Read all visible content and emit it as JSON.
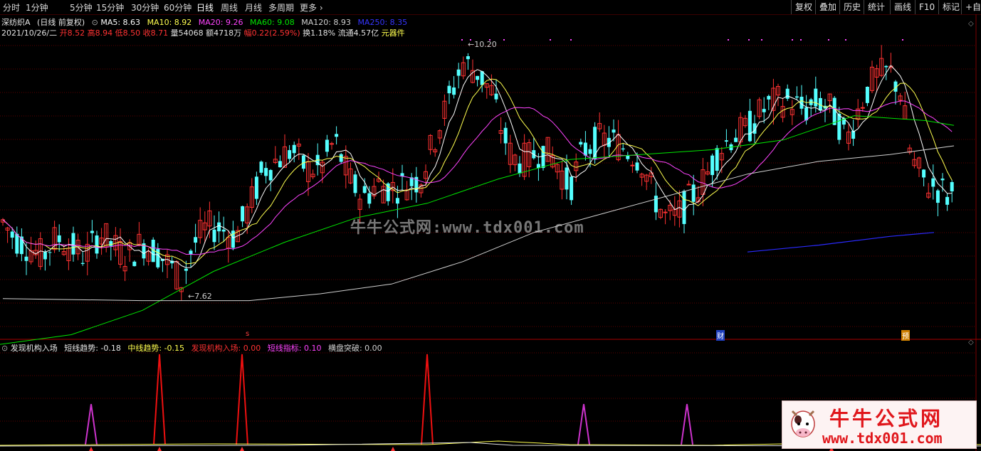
{
  "toolbar": {
    "periods": [
      "分时",
      "1分钟",
      "5分钟",
      "15分钟",
      "30分钟",
      "60分钟",
      "日线",
      "周线",
      "月线",
      "多周期",
      "更多"
    ],
    "active": "日线",
    "right_buttons": [
      "复权",
      "叠加",
      "历史",
      "统计",
      "画线",
      "F10",
      "标记",
      "+自选"
    ]
  },
  "stock": {
    "name": "深纺织A",
    "mode": "(日线 前复权)"
  },
  "ma": {
    "ma5": "MA5: 8.63",
    "ma10": "MA10: 8.92",
    "ma20": "MA20: 9.26",
    "ma60": "MA60: 9.08",
    "ma120": "MA120: 8.93",
    "ma250": "MA250: 8.35"
  },
  "quote": {
    "date": "2021/10/26/二",
    "open_label": "开",
    "open": "8.52",
    "high_label": "高",
    "high": "8.94",
    "low_label": "低",
    "low": "8.50",
    "close_label": "收",
    "close": "8.71",
    "vol_label": "量",
    "vol": "54068",
    "amt_label": "额",
    "amt": "4718万",
    "chg_label": "幅",
    "chg": "0.22(2.59%)",
    "turn_label": "换",
    "turn": "1.18%",
    "float_label": "流通",
    "float": "4.57亿",
    "sector": "元器件"
  },
  "price_marks": {
    "high": "10.20",
    "low": "7.62"
  },
  "event_marks": {
    "s": "s",
    "cai": "财",
    "yu": "预"
  },
  "indicator": {
    "name": "发现机构入场",
    "short_trend": "短线趋势: -0.18",
    "mid_trend": "中线趋势: -0.15",
    "entry": "发现机构入场: 0.00",
    "short_index": "短线指标: 0.10",
    "breakout": "横盘突破: 0.00"
  },
  "watermark": {
    "center": "牛牛公式网:www.tdx001.com",
    "logo_title": "牛牛公式网",
    "logo_url": "www.tdx001.com"
  },
  "colors": {
    "up": "#ff3232",
    "down": "#54ffff",
    "ma5": "#ffffff",
    "ma10": "#ffff4f",
    "ma20": "#ff44ff",
    "ma60": "#00e600",
    "ma120": "#d0d0d0",
    "ma250": "#2a2aff",
    "grid": "#7a0000"
  }
}
